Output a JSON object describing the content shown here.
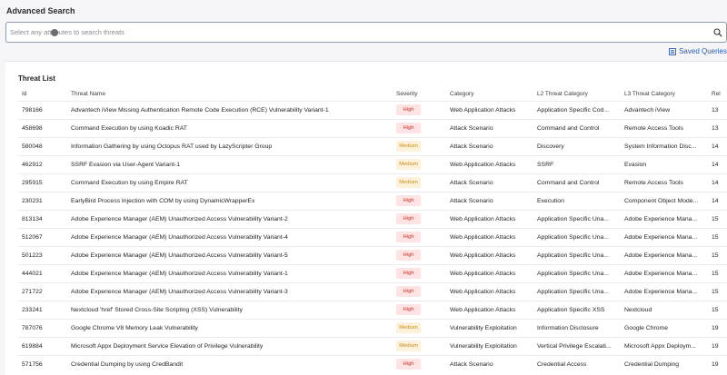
{
  "page": {
    "title": "Advanced Search"
  },
  "search": {
    "placeholder": "Select any attributes to search threats",
    "value": ""
  },
  "toolbar": {
    "saved_queries_label": "Saved Queries"
  },
  "threat_list": {
    "title": "Threat List",
    "columns": [
      "Id",
      "Threat Name",
      "Severity",
      "Category",
      "L2 Threat Category",
      "L3 Threat Category",
      "Rel"
    ],
    "rows": [
      {
        "id": "798166",
        "name": "Advantech iView Missing Authentication Remote Code Execution (RCE) Vulnerability Variant-1",
        "severity": "High",
        "category": "Web Application Attacks",
        "l2": "Application Specific Cod...",
        "l3": "Advantech iView",
        "rel": "13"
      },
      {
        "id": "458698",
        "name": "Command Execution by using Koadic RAT",
        "severity": "High",
        "category": "Attack Scenario",
        "l2": "Command and Control",
        "l3": "Remote Access Tools",
        "rel": "13"
      },
      {
        "id": "580048",
        "name": "Information Gathering by using Octopus RAT used by LazyScripter Group",
        "severity": "Medium",
        "category": "Attack Scenario",
        "l2": "Discovery",
        "l3": "System Information Disc...",
        "rel": "14"
      },
      {
        "id": "462912",
        "name": "SSRF Evasion via User-Agent Variant-1",
        "severity": "Medium",
        "category": "Web Application Attacks",
        "l2": "SSRF",
        "l3": "Evasion",
        "rel": "14"
      },
      {
        "id": "295915",
        "name": "Command Execution by using Empire RAT",
        "severity": "Medium",
        "category": "Attack Scenario",
        "l2": "Command and Control",
        "l3": "Remote Access Tools",
        "rel": "14"
      },
      {
        "id": "230231",
        "name": "EarlyBird Process Injection with COM by using DynamicWrapperEx",
        "severity": "High",
        "category": "Attack Scenario",
        "l2": "Execution",
        "l3": "Component Object Mode...",
        "rel": "14"
      },
      {
        "id": "813134",
        "name": "Adobe Experience Manager (AEM) Unauthorized Access Vulnerability Variant-2",
        "severity": "High",
        "category": "Web Application Attacks",
        "l2": "Application Specific Una...",
        "l3": "Adobe Experience Mana...",
        "rel": "15"
      },
      {
        "id": "512067",
        "name": "Adobe Experience Manager (AEM) Unauthorized Access Vulnerability Variant-4",
        "severity": "High",
        "category": "Web Application Attacks",
        "l2": "Application Specific Una...",
        "l3": "Adobe Experience Mana...",
        "rel": "15"
      },
      {
        "id": "501223",
        "name": "Adobe Experience Manager (AEM) Unauthorized Access Vulnerability Variant-5",
        "severity": "High",
        "category": "Web Application Attacks",
        "l2": "Application Specific Una...",
        "l3": "Adobe Experience Mana...",
        "rel": "15"
      },
      {
        "id": "444021",
        "name": "Adobe Experience Manager (AEM) Unauthorized Access Vulnerability Variant-1",
        "severity": "High",
        "category": "Web Application Attacks",
        "l2": "Application Specific Una...",
        "l3": "Adobe Experience Mana...",
        "rel": "15"
      },
      {
        "id": "271722",
        "name": "Adobe Experience Manager (AEM) Unauthorized Access Vulnerability Variant-3",
        "severity": "High",
        "category": "Web Application Attacks",
        "l2": "Application Specific Una...",
        "l3": "Adobe Experience Mana...",
        "rel": "15"
      },
      {
        "id": "233241",
        "name": "Nextcloud 'href' Stored Cross-Site Scripting (XSS) Vulnerability",
        "severity": "High",
        "category": "Web Application Attacks",
        "l2": "Application Specific XSS",
        "l3": "Nextcloud",
        "rel": "15"
      },
      {
        "id": "787076",
        "name": "Google Chrome V8 Memory Leak Vulnerability",
        "severity": "Medium",
        "category": "Vulnerability Exploitation",
        "l2": "Information Disclosure",
        "l3": "Google Chrome",
        "rel": "19"
      },
      {
        "id": "619884",
        "name": "Microsoft Appx Deployment Service Elevation of Privilege Vulnerability",
        "severity": "Medium",
        "category": "Vulnerability Exploitation",
        "l2": "Vertical Privilege Escalati...",
        "l3": "Microsoft Appx Deploym...",
        "rel": "19"
      },
      {
        "id": "571756",
        "name": "Credential Dumping by using CredBandit",
        "severity": "High",
        "category": "Attack Scenario",
        "l2": "Credential Access",
        "l3": "Credential Dumping",
        "rel": "19"
      }
    ]
  },
  "colors": {
    "accent": "#2a5db0",
    "high_bg": "#fde3e3",
    "high_text": "#c0392b",
    "medium_bg": "#fdf1d9",
    "medium_text": "#c98b13"
  },
  "icons": {
    "search": "search-icon",
    "saved_queries": "saved-queries-icon"
  }
}
